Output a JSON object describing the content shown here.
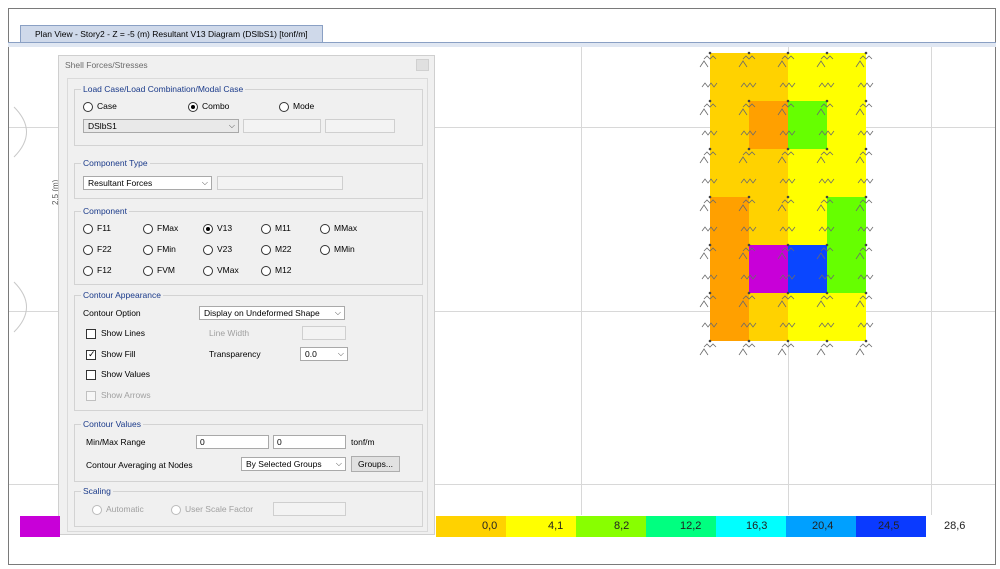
{
  "window": {
    "tab_title": "Plan View - Story2 - Z = -5 (m)   Resultant V13 Diagram   (DSlbS1)  [tonf/m]"
  },
  "canvas": {
    "dimension_label": "2,5 (m)",
    "cells": [
      {
        "row": 0,
        "col": 0,
        "color": "#ffd200"
      },
      {
        "row": 0,
        "col": 1,
        "color": "#ffd200"
      },
      {
        "row": 0,
        "col": 2,
        "color": "#ffff00"
      },
      {
        "row": 0,
        "col": 3,
        "color": "#ffff00"
      },
      {
        "row": 1,
        "col": 0,
        "color": "#ffd200"
      },
      {
        "row": 1,
        "col": 1,
        "color": "#ffa000"
      },
      {
        "row": 1,
        "col": 2,
        "color": "#66ff00"
      },
      {
        "row": 1,
        "col": 3,
        "color": "#ffff00"
      },
      {
        "row": 2,
        "col": 0,
        "color": "#ffd200"
      },
      {
        "row": 2,
        "col": 1,
        "color": "#ffd200"
      },
      {
        "row": 2,
        "col": 2,
        "color": "#ffff00"
      },
      {
        "row": 2,
        "col": 3,
        "color": "#ffff00"
      },
      {
        "row": 3,
        "col": 0,
        "color": "#ffa000"
      },
      {
        "row": 3,
        "col": 1,
        "color": "#ffd200"
      },
      {
        "row": 3,
        "col": 2,
        "color": "#ffff00"
      },
      {
        "row": 3,
        "col": 3,
        "color": "#66ff00"
      },
      {
        "row": 4,
        "col": 0,
        "color": "#ffa000"
      },
      {
        "row": 4,
        "col": 1,
        "color": "#c800d8"
      },
      {
        "row": 4,
        "col": 2,
        "color": "#0a46ff"
      },
      {
        "row": 4,
        "col": 3,
        "color": "#66ff00"
      },
      {
        "row": 5,
        "col": 0,
        "color": "#ffa000"
      },
      {
        "row": 5,
        "col": 1,
        "color": "#ffd200"
      },
      {
        "row": 5,
        "col": 2,
        "color": "#ffff00"
      },
      {
        "row": 5,
        "col": 3,
        "color": "#ffff00"
      }
    ]
  },
  "legend": {
    "values": [
      "0,0",
      "4,1",
      "8,2",
      "12,2",
      "16,3",
      "20,4",
      "24,5",
      "28,6"
    ],
    "colors": [
      "#c800d8",
      "#ffd200",
      "#ffff00",
      "#88ff00",
      "#00ff80",
      "#00ffff",
      "#00a0ff",
      "#0a3aff"
    ]
  },
  "dialog": {
    "title": "Shell Forces/Stresses",
    "load_case": {
      "group_title": "Load Case/Load Combination/Modal Case",
      "options": [
        "Case",
        "Combo",
        "Mode"
      ],
      "selected": "Combo",
      "combo_value": "DSlbS1"
    },
    "component_type": {
      "group_title": "Component Type",
      "value": "Resultant Forces"
    },
    "component": {
      "group_title": "Component",
      "options": [
        [
          "F11",
          "FMax",
          "V13",
          "M11",
          "MMax"
        ],
        [
          "F22",
          "FMin",
          "V23",
          "M22",
          "MMin"
        ],
        [
          "F12",
          "FVM",
          "VMax",
          "M12"
        ]
      ],
      "selected": "V13"
    },
    "contour_appearance": {
      "group_title": "Contour Appearance",
      "contour_option_label": "Contour Option",
      "contour_option_value": "Display on Undeformed Shape",
      "show_lines": "Show Lines",
      "line_width": "Line Width",
      "show_fill": "Show Fill",
      "transparency_label": "Transparency",
      "transparency_value": "0.0",
      "show_values": "Show Values",
      "show_arrows": "Show Arrows"
    },
    "contour_values": {
      "group_title": "Contour Values",
      "range_label": "Min/Max Range",
      "min": "0",
      "max": "0",
      "unit": "tonf/m",
      "averaging_label": "Contour Averaging at Nodes",
      "averaging_value": "By Selected Groups",
      "groups_button": "Groups..."
    },
    "scaling": {
      "group_title": "Scaling",
      "automatic": "Automatic",
      "user_scale": "User Scale Factor"
    }
  }
}
